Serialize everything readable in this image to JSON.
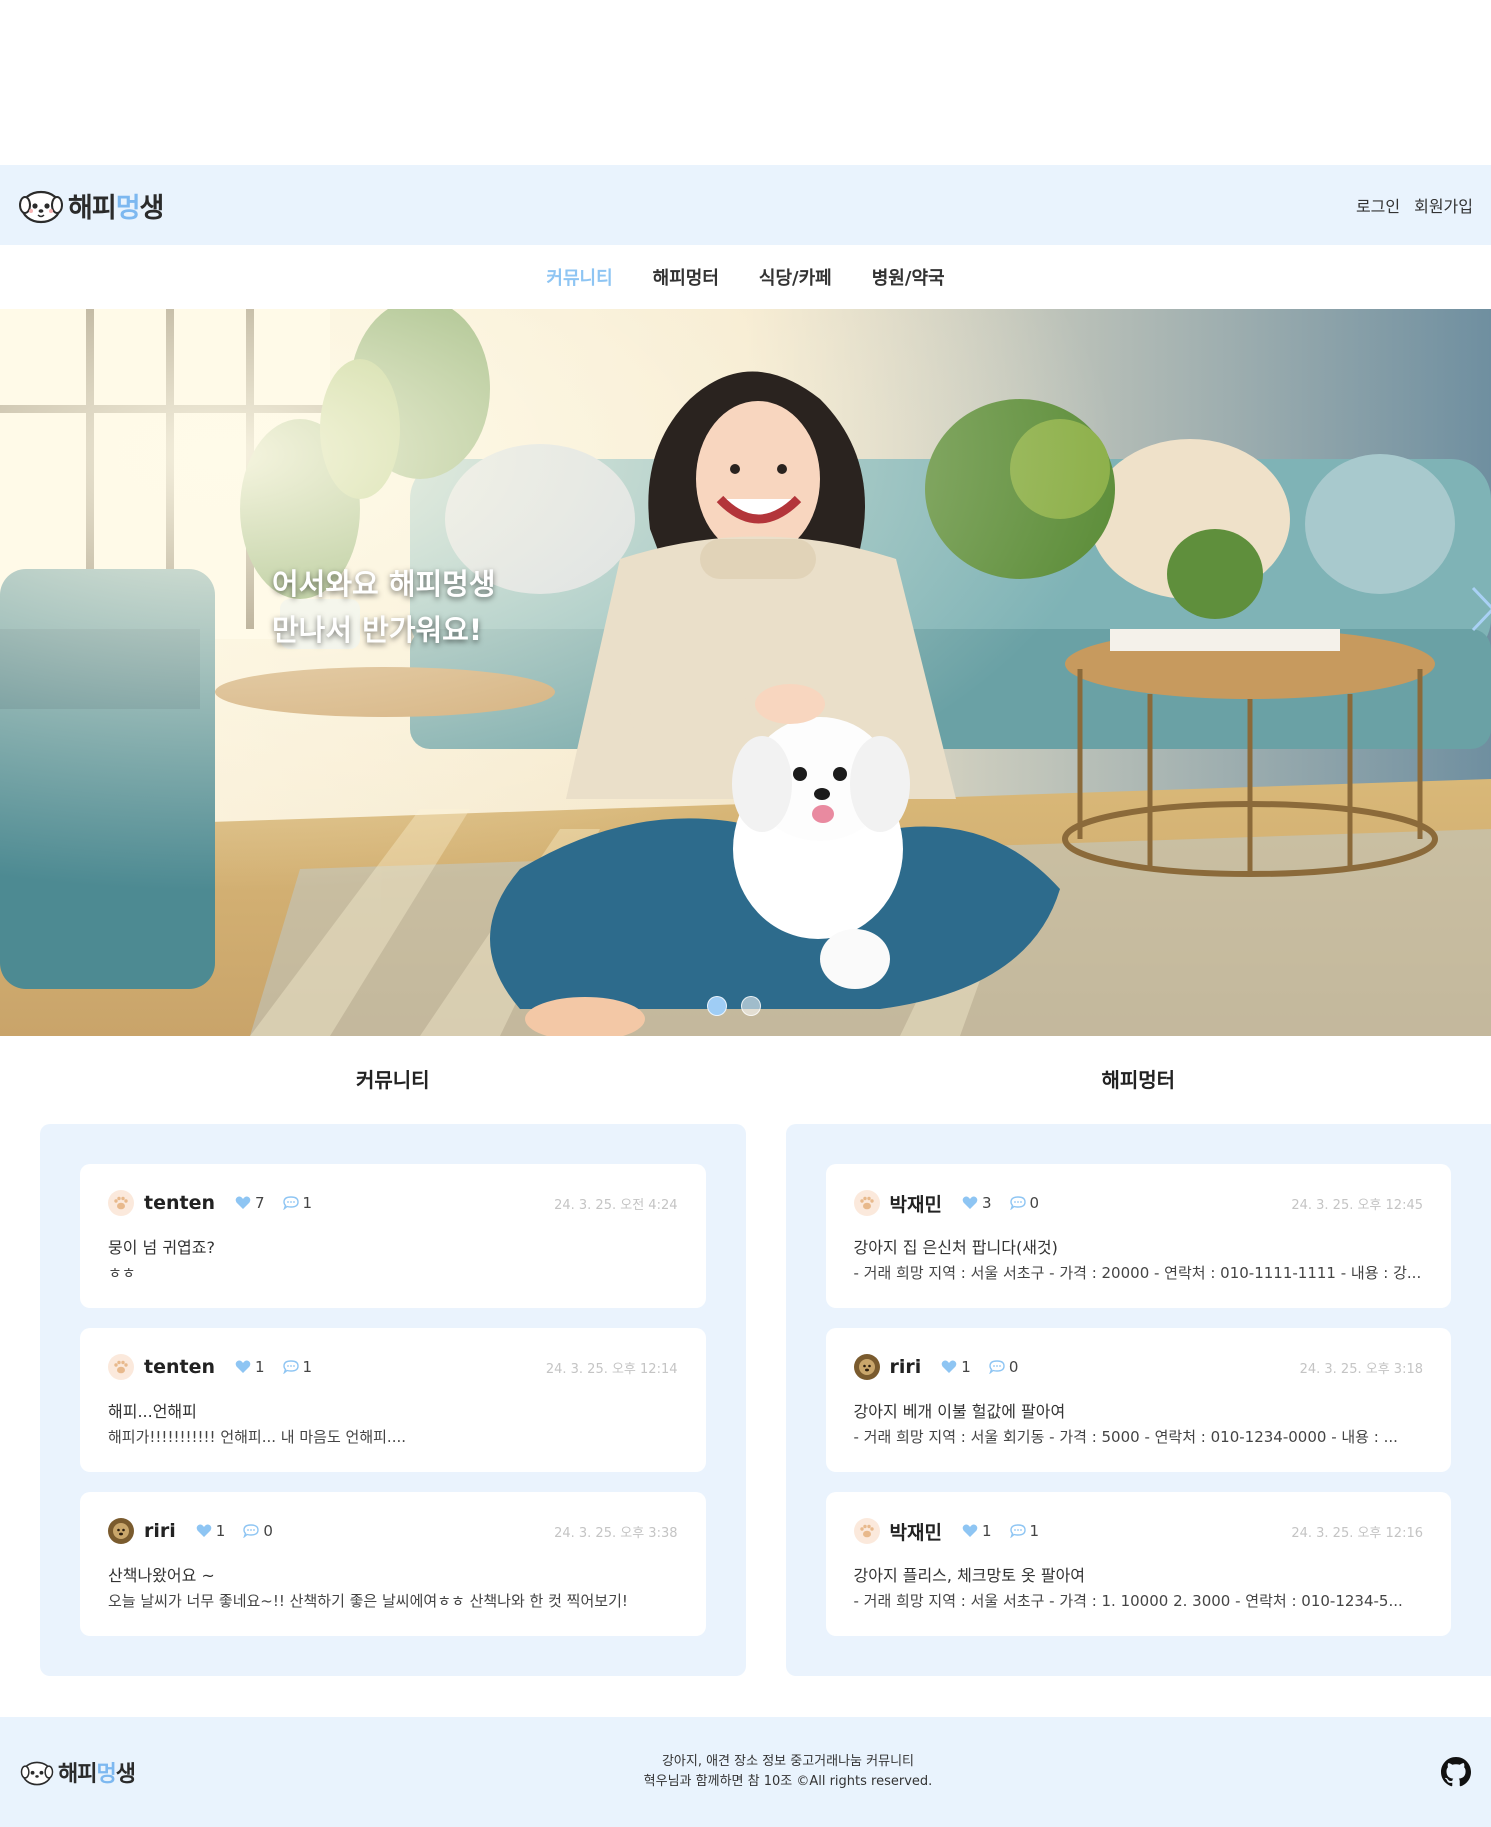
{
  "header": {
    "logo_text_a": "해피",
    "logo_text_b": "멍",
    "logo_text_c": "생",
    "login": "로그인",
    "signup": "회원가입"
  },
  "nav": {
    "items": [
      {
        "label": "커뮤니티",
        "active": true
      },
      {
        "label": "해피멍터",
        "active": false
      },
      {
        "label": "식당/카페",
        "active": false
      },
      {
        "label": "병원/약국",
        "active": false
      }
    ]
  },
  "hero": {
    "line1": "어서와요 해피멍생",
    "line2": "만나서 반가워요!",
    "slides": 2,
    "current_slide": 1
  },
  "community": {
    "title": "커뮤니티",
    "posts": [
      {
        "author": "tenten",
        "likes": "7",
        "comments": "1",
        "date": "24. 3. 25. 오전 4:24",
        "title": "뭉이 넘 귀엽죠?",
        "body": "ㅎㅎ",
        "avatar": "paw"
      },
      {
        "author": "tenten",
        "likes": "1",
        "comments": "1",
        "date": "24. 3. 25. 오후 12:14",
        "title": "해피...언해피",
        "body": "해피가!!!!!!!!!!! 언해피... 내 마음도 언해피....",
        "avatar": "paw"
      },
      {
        "author": "riri",
        "likes": "1",
        "comments": "0",
        "date": "24. 3. 25. 오후 3:38",
        "title": "산책나왔어요 ~",
        "body": "오늘 날씨가 너무 좋네요~!! 산책하기 좋은 날씨에여ㅎㅎ 산책나와 한 컷 찍어보기!",
        "avatar": "photo"
      }
    ]
  },
  "mentor": {
    "title": "해피멍터",
    "posts": [
      {
        "author": "박재민",
        "likes": "3",
        "comments": "0",
        "date": "24. 3. 25. 오후 12:45",
        "title": "강아지 집 은신처 팝니다(새것)",
        "body": "- 거래 희망 지역 : 서울 서초구 - 가격 : 20000 - 연락처 : 010-1111-1111 - 내용 : 강...",
        "avatar": "paw"
      },
      {
        "author": "riri",
        "likes": "1",
        "comments": "0",
        "date": "24. 3. 25. 오후 3:18",
        "title": "강아지 베개 이불 헐값에 팔아여",
        "body": "- 거래 희망 지역 : 서울 회기동 - 가격 : 5000 - 연락처 : 010-1234-0000 - 내용 : ...",
        "avatar": "photo"
      },
      {
        "author": "박재민",
        "likes": "1",
        "comments": "1",
        "date": "24. 3. 25. 오후 12:16",
        "title": "강아지 플리스, 체크망토 옷 팔아여",
        "body": "- 거래 희망 지역 : 서울 서초구 - 가격 : 1. 10000 2. 3000 - 연락처 : 010-1234-5...",
        "avatar": "paw"
      }
    ]
  },
  "footer": {
    "line1": "강아지, 애견 장소 정보 중고거래나눔 커뮤니티",
    "line2": "혁우님과 함께하면 참 10조 ©All rights reserved."
  },
  "colors": {
    "accent": "#8ec5f3",
    "panel_bg": "#eaf3fd",
    "header_bg": "#e9f3fd"
  },
  "icons": [
    "dog-logo-icon",
    "heart-icon",
    "comment-icon",
    "paw-icon",
    "chevron-right-icon",
    "github-icon"
  ]
}
